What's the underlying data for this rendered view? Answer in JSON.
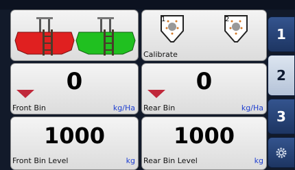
{
  "tiles": {
    "bins_graphic": {
      "front_color": "#e02020",
      "rear_color": "#20c020"
    },
    "calibrate": {
      "label": "Calibrate",
      "left_num": "1",
      "right_num": "2"
    },
    "front_rate": {
      "value": "0",
      "label": "Front Bin",
      "unit": "kg/Ha"
    },
    "rear_rate": {
      "value": "0",
      "label": "Rear Bin",
      "unit": "kg/Ha"
    },
    "front_level": {
      "value": "1000",
      "label": "Front Bin Level",
      "unit": "kg"
    },
    "rear_level": {
      "value": "1000",
      "label": "Rear Bin Level",
      "unit": "kg"
    }
  },
  "tabs": [
    {
      "label": "1",
      "active": false
    },
    {
      "label": "2",
      "active": true
    },
    {
      "label": "3",
      "active": false
    },
    {
      "icon": "gear-icon",
      "active": false
    }
  ]
}
